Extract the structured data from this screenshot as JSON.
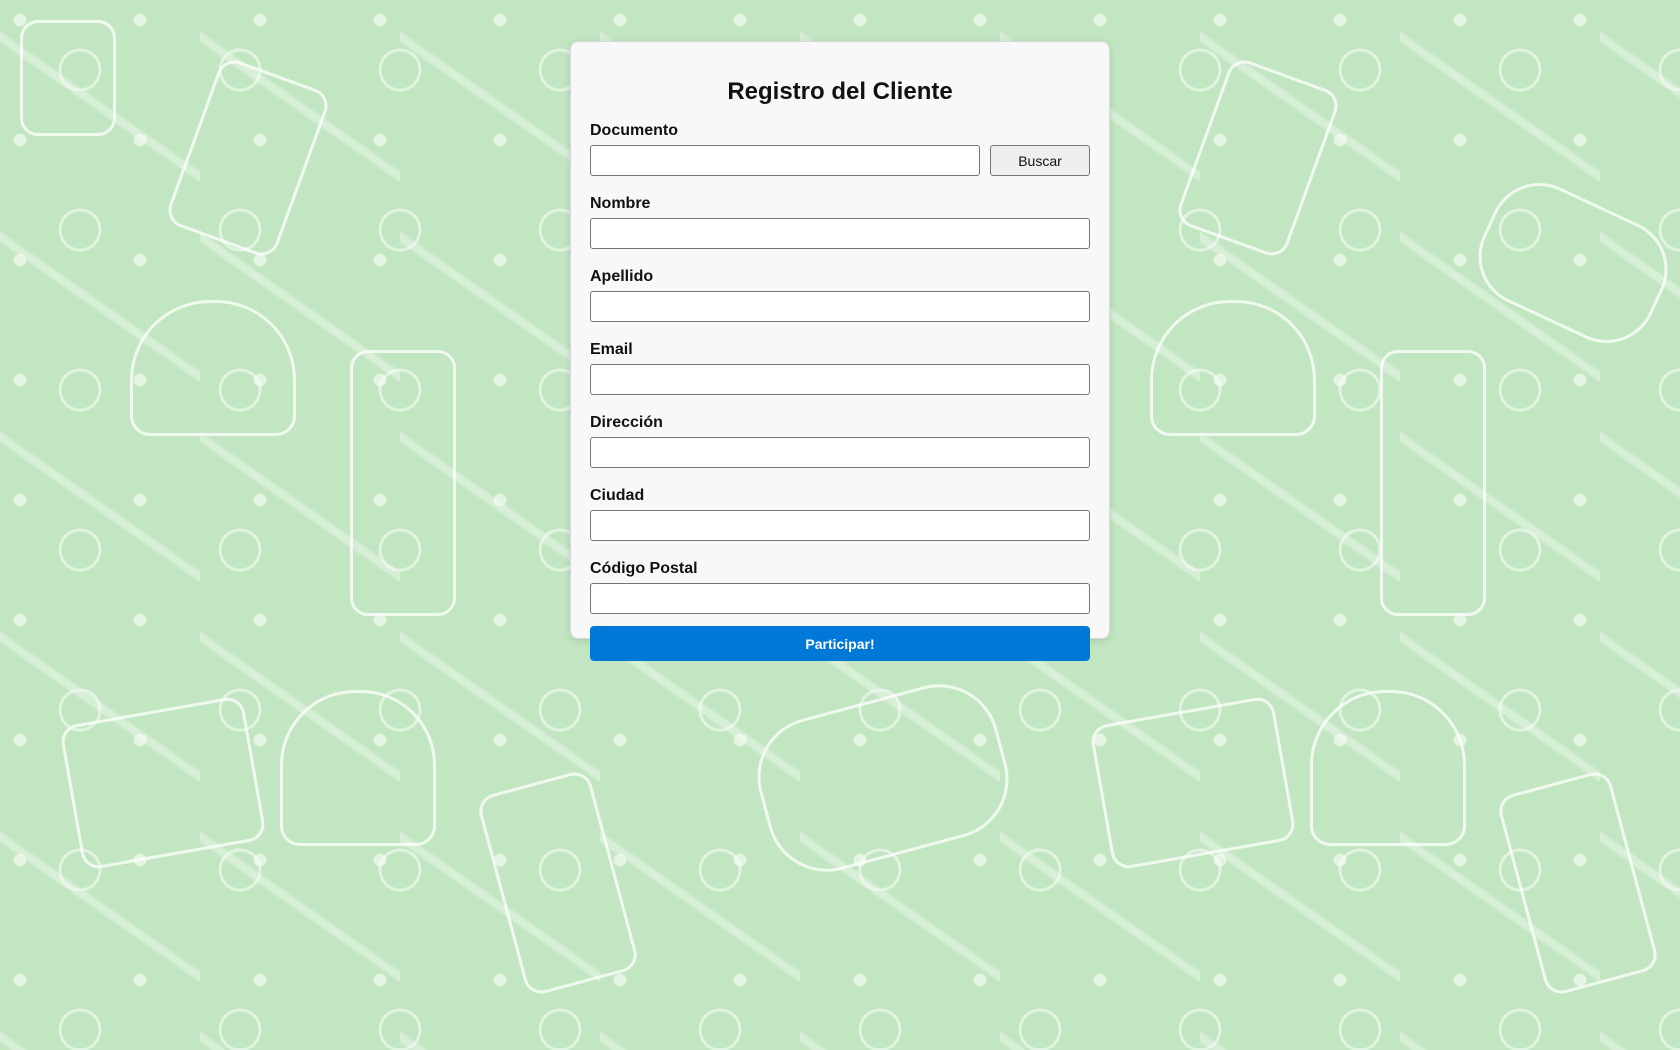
{
  "form": {
    "title": "Registro del Cliente",
    "document_label": "Documento",
    "document_value": "",
    "search_label": "Buscar",
    "fields": [
      {
        "label": "Nombre",
        "value": ""
      },
      {
        "label": "Apellido",
        "value": ""
      },
      {
        "label": "Email",
        "value": ""
      },
      {
        "label": "Dirección",
        "value": ""
      },
      {
        "label": "Ciudad",
        "value": ""
      },
      {
        "label": "Código Postal",
        "value": ""
      }
    ],
    "submit_label": "Participar!"
  },
  "colors": {
    "background": "#c3e6c2",
    "card": "#f8f8f8",
    "primary_button": "#0078d7"
  },
  "background_pattern_icons": [
    "smartwatch-icon",
    "smartphone-icon",
    "headphones-icon",
    "blender-icon",
    "gamepad-icon",
    "laptop-icon"
  ]
}
